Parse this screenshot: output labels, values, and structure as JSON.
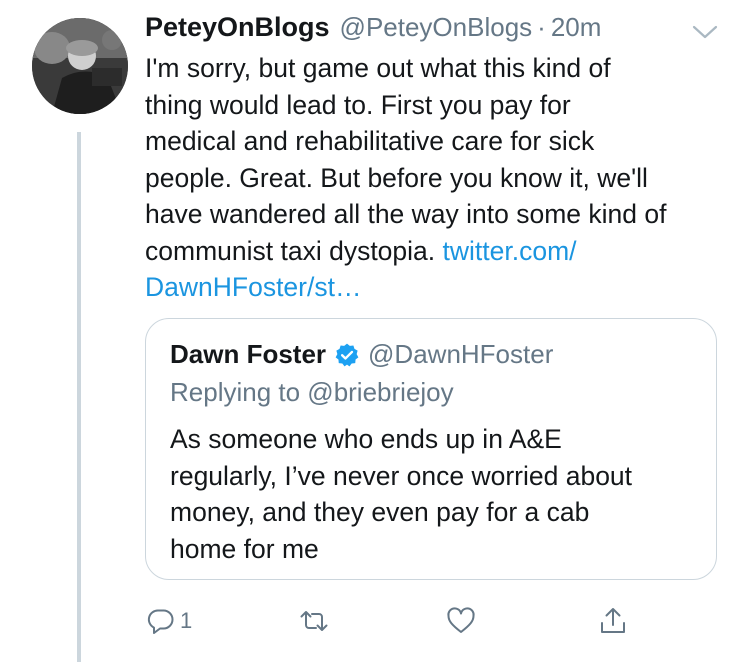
{
  "tweet": {
    "display_name": "PeteyOnBlogs",
    "handle": "@PeteyOnBlogs",
    "separator": "·",
    "time": "20m",
    "text_line1": "I'm sorry, but game out what this kind of",
    "text_line2": "thing would lead to. First you pay for",
    "text_line3": "medical and rehabilitative care for sick",
    "text_line4": "people. Great. But before you know it, we'll",
    "text_line5": "have wandered all the way into some kind of",
    "text_line6_text": "communist taxi dystopia.",
    "link_part1": "twitter.com/",
    "link_part2": "DawnHFoster/st…"
  },
  "quote": {
    "display_name": "Dawn Foster",
    "handle": "@DawnHFoster",
    "replying_to": "Replying to @briebriejoy",
    "text_line1": "As someone who ends up in A&E",
    "text_line2": "regularly, I’ve never once worried about",
    "text_line3": "money, and they even pay for a cab",
    "text_line4": "home for me"
  },
  "actions": {
    "reply_count": "1"
  },
  "colors": {
    "text": "#14171a",
    "secondary": "#657786",
    "link": "#1b95e0",
    "border": "#ccd6dd"
  },
  "icons": [
    "avatar",
    "chevron-down-icon",
    "verified-badge-icon",
    "reply-icon",
    "retweet-icon",
    "like-icon",
    "share-icon"
  ]
}
